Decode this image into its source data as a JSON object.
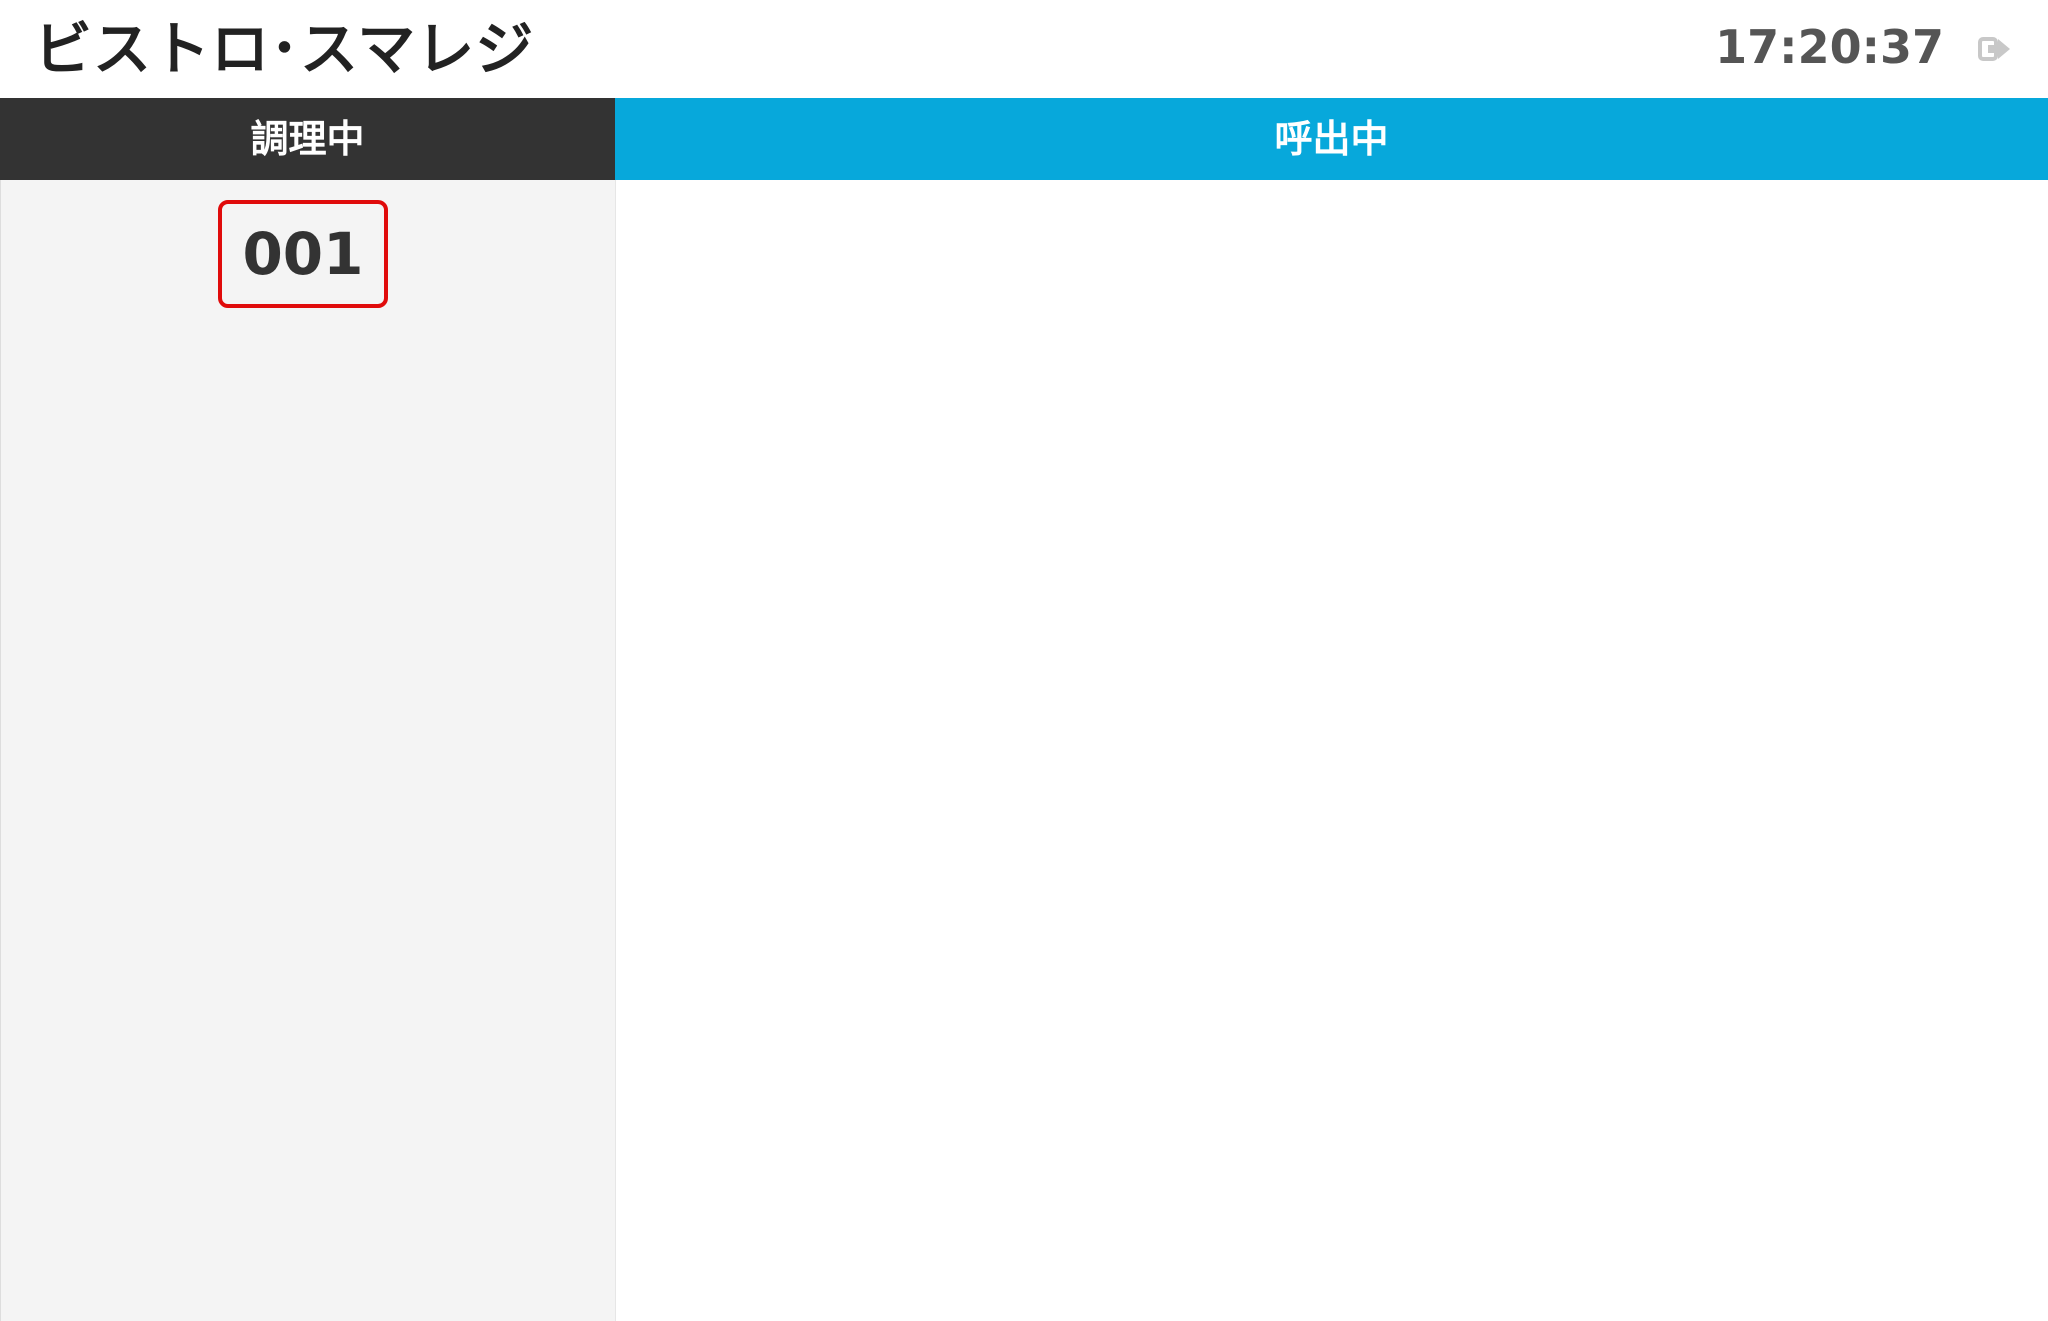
{
  "header": {
    "title": "ビストロ･スマレジ",
    "clock": "17:20:37",
    "exit_icon": "logout-icon"
  },
  "columns": {
    "cooking": {
      "label": "調理中",
      "color": "#333333",
      "orders": [
        "001"
      ]
    },
    "calling": {
      "label": "呼出中",
      "color": "#07a8db",
      "orders": []
    }
  },
  "colors": {
    "card_border": "#e00b0b"
  }
}
